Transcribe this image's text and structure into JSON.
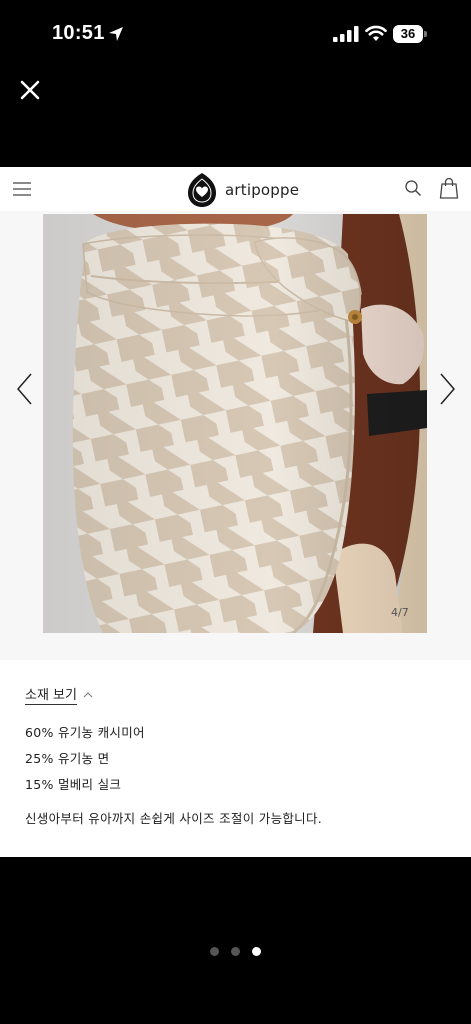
{
  "status_bar": {
    "time": "10:51",
    "battery_level": "36",
    "icons": [
      "location-arrow-icon",
      "cellular-signal-icon",
      "wifi-icon",
      "battery-icon"
    ]
  },
  "overlay": {
    "close_icon": "close-icon"
  },
  "site": {
    "brand": "artipoppe",
    "icons": [
      "hamburger-menu-icon",
      "logo-mark",
      "search-icon",
      "shopping-bag-icon"
    ]
  },
  "gallery": {
    "counter": "4/7",
    "prev_icon": "chevron-left-icon",
    "next_icon": "chevron-right-icon"
  },
  "materials": {
    "toggle_label": "소재 보기",
    "items": [
      "60% 유기농 캐시미어",
      "25% 유기농 면",
      "15% 멀베리 실크"
    ],
    "description": "신생아부터 유아까지 손쉽게 사이즈 조절이 가능합니다."
  },
  "pagination": {
    "total": 3,
    "active_index": 3
  },
  "colors": {
    "background": "#000000",
    "page": "#ffffff",
    "gallery_bg": "#f7f7f7",
    "dot_inactive": "#555555",
    "dot_active": "#ffffff"
  }
}
